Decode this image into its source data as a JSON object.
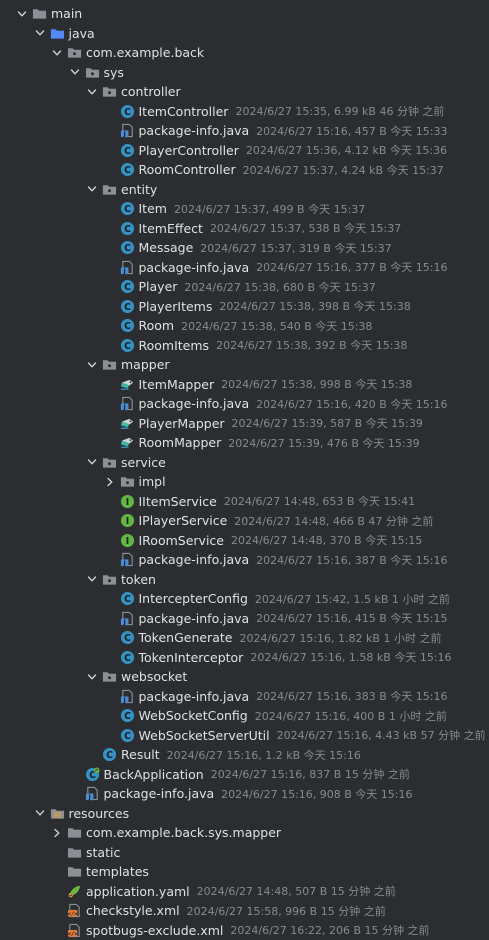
{
  "tree": [
    {
      "level": 0,
      "expand": "open",
      "icon": "folder",
      "name": "main",
      "meta": ""
    },
    {
      "level": 1,
      "expand": "open",
      "icon": "folder-blue",
      "name": "java",
      "meta": ""
    },
    {
      "level": 2,
      "expand": "open",
      "icon": "package",
      "name": "com.example.back",
      "meta": ""
    },
    {
      "level": 3,
      "expand": "open",
      "icon": "package",
      "name": "sys",
      "meta": ""
    },
    {
      "level": 4,
      "expand": "open",
      "icon": "package",
      "name": "controller",
      "meta": ""
    },
    {
      "level": 5,
      "expand": "none",
      "icon": "class",
      "name": "ItemController",
      "meta": "2024/6/27 15:35, 6.99 kB 46 分钟 之前"
    },
    {
      "level": 5,
      "expand": "none",
      "icon": "package-info",
      "name": "package-info.java",
      "meta": "2024/6/27 15:16, 457 B 今天 15:33"
    },
    {
      "level": 5,
      "expand": "none",
      "icon": "class",
      "name": "PlayerController",
      "meta": "2024/6/27 15:36, 4.12 kB 今天 15:36"
    },
    {
      "level": 5,
      "expand": "none",
      "icon": "class",
      "name": "RoomController",
      "meta": "2024/6/27 15:37, 4.24 kB 今天 15:37"
    },
    {
      "level": 4,
      "expand": "open",
      "icon": "package",
      "name": "entity",
      "meta": ""
    },
    {
      "level": 5,
      "expand": "none",
      "icon": "class",
      "name": "Item",
      "meta": "2024/6/27 15:37, 499 B 今天 15:37"
    },
    {
      "level": 5,
      "expand": "none",
      "icon": "class",
      "name": "ItemEffect",
      "meta": "2024/6/27 15:37, 538 B 今天 15:37"
    },
    {
      "level": 5,
      "expand": "none",
      "icon": "class",
      "name": "Message",
      "meta": "2024/6/27 15:37, 319 B 今天 15:37"
    },
    {
      "level": 5,
      "expand": "none",
      "icon": "package-info",
      "name": "package-info.java",
      "meta": "2024/6/27 15:16, 377 B 今天 15:16"
    },
    {
      "level": 5,
      "expand": "none",
      "icon": "class",
      "name": "Player",
      "meta": "2024/6/27 15:38, 680 B 今天 15:37"
    },
    {
      "level": 5,
      "expand": "none",
      "icon": "class",
      "name": "PlayerItems",
      "meta": "2024/6/27 15:38, 398 B 今天 15:38"
    },
    {
      "level": 5,
      "expand": "none",
      "icon": "class",
      "name": "Room",
      "meta": "2024/6/27 15:38, 540 B 今天 15:38"
    },
    {
      "level": 5,
      "expand": "none",
      "icon": "class",
      "name": "RoomItems",
      "meta": "2024/6/27 15:38, 392 B 今天 15:38"
    },
    {
      "level": 4,
      "expand": "open",
      "icon": "package",
      "name": "mapper",
      "meta": ""
    },
    {
      "level": 5,
      "expand": "none",
      "icon": "mapper",
      "name": "ItemMapper",
      "meta": "2024/6/27 15:38, 998 B 今天 15:38"
    },
    {
      "level": 5,
      "expand": "none",
      "icon": "package-info",
      "name": "package-info.java",
      "meta": "2024/6/27 15:16, 420 B 今天 15:16"
    },
    {
      "level": 5,
      "expand": "none",
      "icon": "mapper",
      "name": "PlayerMapper",
      "meta": "2024/6/27 15:39, 587 B 今天 15:39"
    },
    {
      "level": 5,
      "expand": "none",
      "icon": "mapper",
      "name": "RoomMapper",
      "meta": "2024/6/27 15:39, 476 B 今天 15:39"
    },
    {
      "level": 4,
      "expand": "open",
      "icon": "package",
      "name": "service",
      "meta": ""
    },
    {
      "level": 5,
      "expand": "closed",
      "icon": "package",
      "name": "impl",
      "meta": ""
    },
    {
      "level": 5,
      "expand": "none",
      "icon": "interface",
      "name": "IItemService",
      "meta": "2024/6/27 14:48, 653 B 今天 15:41"
    },
    {
      "level": 5,
      "expand": "none",
      "icon": "interface",
      "name": "IPlayerService",
      "meta": "2024/6/27 14:48, 466 B 47 分钟 之前"
    },
    {
      "level": 5,
      "expand": "none",
      "icon": "interface",
      "name": "IRoomService",
      "meta": "2024/6/27 14:48, 370 B 今天 15:15"
    },
    {
      "level": 5,
      "expand": "none",
      "icon": "package-info",
      "name": "package-info.java",
      "meta": "2024/6/27 15:16, 387 B 今天 15:16"
    },
    {
      "level": 4,
      "expand": "open",
      "icon": "package",
      "name": "token",
      "meta": ""
    },
    {
      "level": 5,
      "expand": "none",
      "icon": "class",
      "name": "IntercepterConfig",
      "meta": "2024/6/27 15:42, 1.5 kB 1 小时 之前"
    },
    {
      "level": 5,
      "expand": "none",
      "icon": "package-info",
      "name": "package-info.java",
      "meta": "2024/6/27 15:16, 415 B 今天 15:15"
    },
    {
      "level": 5,
      "expand": "none",
      "icon": "class",
      "name": "TokenGenerate",
      "meta": "2024/6/27 15:16, 1.82 kB 1 小时 之前"
    },
    {
      "level": 5,
      "expand": "none",
      "icon": "class",
      "name": "TokenInterceptor",
      "meta": "2024/6/27 15:16, 1.58 kB 今天 15:16"
    },
    {
      "level": 4,
      "expand": "open",
      "icon": "package",
      "name": "websocket",
      "meta": ""
    },
    {
      "level": 5,
      "expand": "none",
      "icon": "package-info",
      "name": "package-info.java",
      "meta": "2024/6/27 15:16, 383 B 今天 15:16"
    },
    {
      "level": 5,
      "expand": "none",
      "icon": "class",
      "name": "WebSocketConfig",
      "meta": "2024/6/27 15:16, 400 B 1 小时 之前"
    },
    {
      "level": 5,
      "expand": "none",
      "icon": "class",
      "name": "WebSocketServerUtil",
      "meta": "2024/6/27 15:16, 4.43 kB 57 分钟 之前"
    },
    {
      "level": 4,
      "expand": "none",
      "icon": "class",
      "name": "Result",
      "meta": "2024/6/27 15:16, 1.2 kB 今天 15:16"
    },
    {
      "level": 3,
      "expand": "none",
      "icon": "spring-class",
      "name": "BackApplication",
      "meta": "2024/6/27 15:16, 837 B 15 分钟 之前"
    },
    {
      "level": 3,
      "expand": "none",
      "icon": "package-info",
      "name": "package-info.java",
      "meta": "2024/6/27 15:16, 908 B 今天 15:16"
    },
    {
      "level": 1,
      "expand": "open",
      "icon": "resources",
      "name": "resources",
      "meta": ""
    },
    {
      "level": 2,
      "expand": "closed",
      "icon": "folder",
      "name": "com.example.back.sys.mapper",
      "meta": ""
    },
    {
      "level": 2,
      "expand": "none",
      "icon": "folder",
      "name": "static",
      "meta": ""
    },
    {
      "level": 2,
      "expand": "none",
      "icon": "folder",
      "name": "templates",
      "meta": ""
    },
    {
      "level": 2,
      "expand": "none",
      "icon": "yaml",
      "name": "application.yaml",
      "meta": "2024/6/27 14:48, 507 B 15 分钟 之前"
    },
    {
      "level": 2,
      "expand": "none",
      "icon": "xml",
      "name": "checkstyle.xml",
      "meta": "2024/6/27 15:58, 996 B 15 分钟 之前"
    },
    {
      "level": 2,
      "expand": "none",
      "icon": "xml",
      "name": "spotbugs-exclude.xml",
      "meta": "2024/6/27 16:22, 206 B 15 分钟 之前"
    }
  ]
}
